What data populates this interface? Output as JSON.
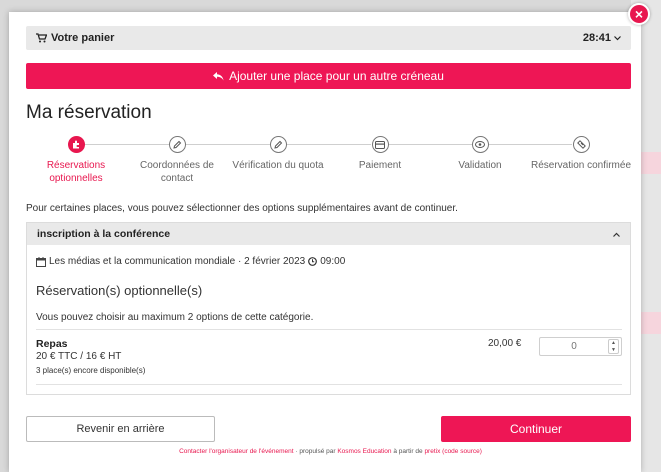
{
  "cart": {
    "label": "Votre panier",
    "timer": "28:41"
  },
  "add_button": {
    "label": "Ajouter une place pour un autre créneau"
  },
  "page_title": "Ma réservation",
  "steps": [
    {
      "label": "Réservations optionnelles",
      "icon": "puzzle-icon",
      "active": true
    },
    {
      "label": "Coordonnées de contact",
      "icon": "pencil-icon",
      "active": false
    },
    {
      "label": "Vérification du quota",
      "icon": "pencil-icon",
      "active": false
    },
    {
      "label": "Paiement",
      "icon": "credit-card-icon",
      "active": false
    },
    {
      "label": "Validation",
      "icon": "eye-icon",
      "active": false
    },
    {
      "label": "Réservation confirmée",
      "icon": "ticket-icon",
      "active": false
    }
  ],
  "intro": "Pour certaines places, vous pouvez sélectionner des options supplémentaires avant de continuer.",
  "panel": {
    "title": "inscription à la conférence",
    "event": "Les médias et la communication mondiale · 2 février 2023",
    "event_time": "09:00",
    "subtitle": "Réservation(s) optionnelle(s)",
    "max_text": "Vous pouvez choisir au maximum 2 options de cette catégorie.",
    "option": {
      "name": "Repas",
      "price_detail": "20 € TTC / 16 € HT",
      "availability": "3 place(s) encore disponible(s)",
      "price": "20,00 €",
      "quantity_placeholder": "0"
    }
  },
  "buttons": {
    "back": "Revenir en arrière",
    "continue": "Continuer"
  },
  "footer": {
    "contact": "Contacter l'organisateur de l'événement",
    "sep": " · ",
    "powered": "propulsé par",
    "brand": "Kosmos Education",
    "based": "à partir de",
    "pretix": "pretix",
    "source": "(code source)"
  },
  "colors": {
    "accent": "#ee1655",
    "bar_bg": "#e9e9e9"
  }
}
